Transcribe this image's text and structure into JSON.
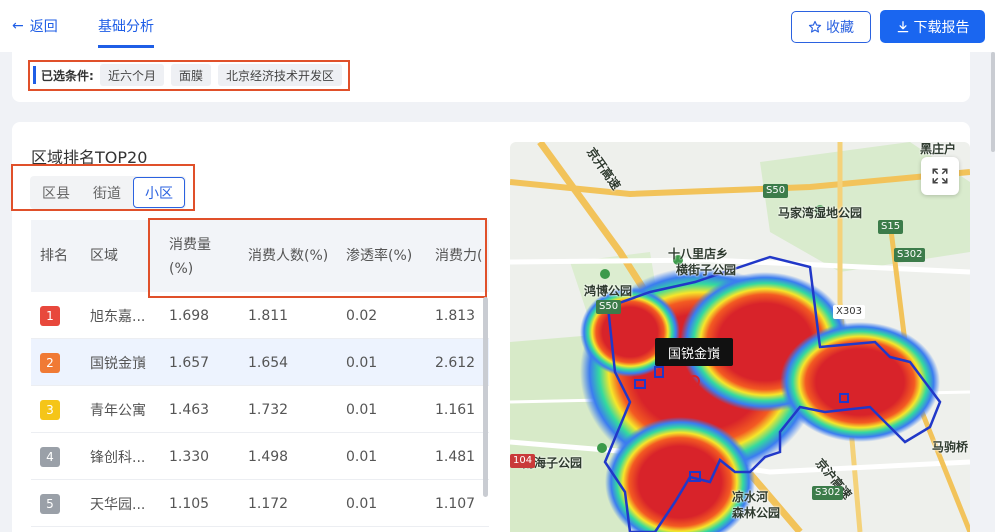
{
  "header": {
    "back_label": "返回",
    "tab_label": "基础分析",
    "favorite_label": "收藏",
    "download_label": "下载报告"
  },
  "filters": {
    "label": "已选条件:",
    "chips": [
      "近六个月",
      "面膜",
      "北京经济技术开发区"
    ]
  },
  "section": {
    "title": "区域排名TOP20",
    "segments": [
      "区县",
      "街道",
      "小区"
    ],
    "active_segment": "小区"
  },
  "table": {
    "headers": {
      "rank": "排名",
      "region": "区域",
      "consumption_line1": "消费量",
      "consumption_line2": "(%)",
      "consumers": "消费人数(%)",
      "penetration": "渗透率(%)",
      "power": "消费力("
    },
    "rows": [
      {
        "rank": "1",
        "region": "旭东嘉...",
        "consumption": "1.698",
        "consumers": "1.811",
        "penetration": "0.02",
        "power": "1.813",
        "color": "#e8483c"
      },
      {
        "rank": "2",
        "region": "国锐金嵿",
        "consumption": "1.657",
        "consumers": "1.654",
        "penetration": "0.01",
        "power": "2.612",
        "color": "#f07a35"
      },
      {
        "rank": "3",
        "region": "青年公寓",
        "consumption": "1.463",
        "consumers": "1.732",
        "penetration": "0.01",
        "power": "1.161",
        "color": "#f5c518"
      },
      {
        "rank": "4",
        "region": "锋创科...",
        "consumption": "1.330",
        "consumers": "1.498",
        "penetration": "0.01",
        "power": "1.481",
        "color": "#9aa0a8"
      },
      {
        "rank": "5",
        "region": "天华园...",
        "consumption": "1.105",
        "consumers": "1.172",
        "penetration": "0.01",
        "power": "1.107",
        "color": "#9aa0a8"
      }
    ]
  },
  "map": {
    "tooltip": "国锐金嵿",
    "labels": {
      "a": "马家湾湿地公园",
      "b": "十八里店乡",
      "c": "横街子公园",
      "d": "鸿博公园",
      "e": "南海子公园",
      "f": "马驹桥",
      "g": "凉水河",
      "h": "森林公园",
      "i": "黑庄户",
      "j": "京开高速",
      "k": "京沪高速"
    },
    "roads": [
      "S50",
      "S15",
      "S302",
      "X303",
      "S50",
      "S302",
      "104"
    ]
  },
  "colors": {
    "primary": "#1f5ee6",
    "highlight_border": "#e0502a"
  }
}
